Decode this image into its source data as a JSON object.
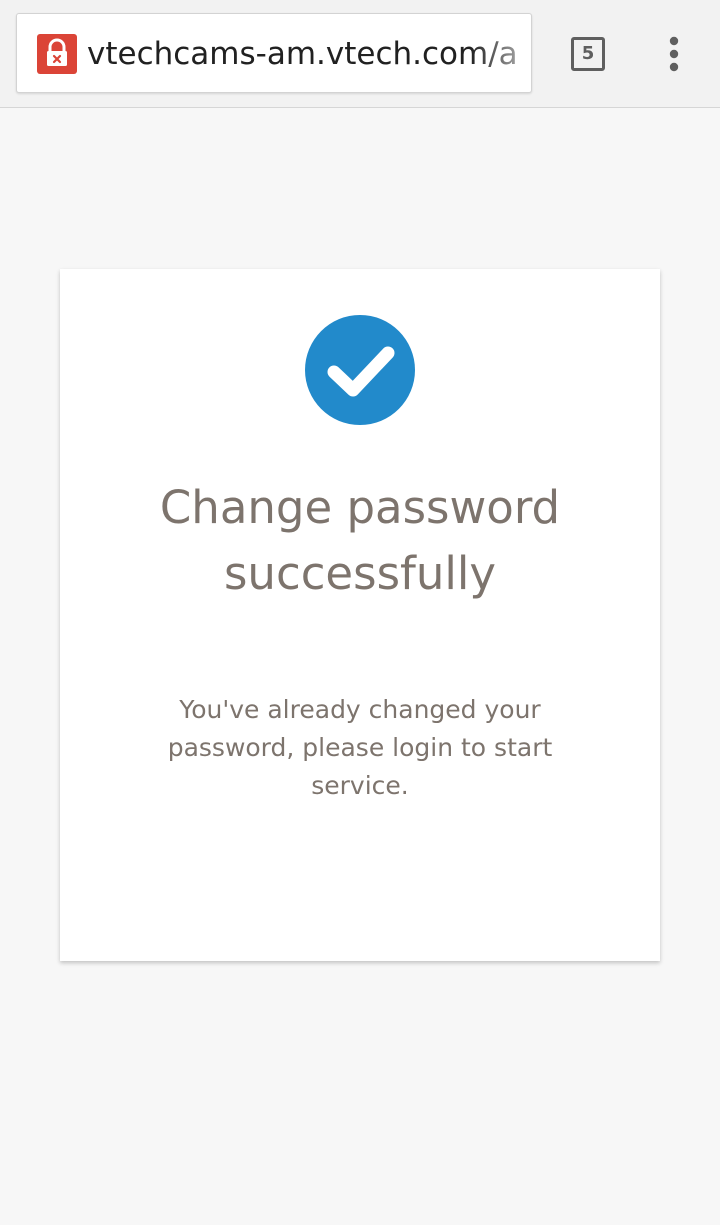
{
  "browser": {
    "url": "vtechcams-am.vtech.com/a",
    "tab_count": "5",
    "security_icon": "broken-lock-icon",
    "menu_icon": "overflow-menu-icon"
  },
  "card": {
    "icon": "checkmark-circle-icon",
    "title": "Change password successfully",
    "message": "You've already changed your password, please login to start service."
  },
  "colors": {
    "lock_red": "#db4437",
    "check_blue": "#228acb",
    "text_gray": "#7d746d",
    "page_background": "#f7f7f7"
  }
}
